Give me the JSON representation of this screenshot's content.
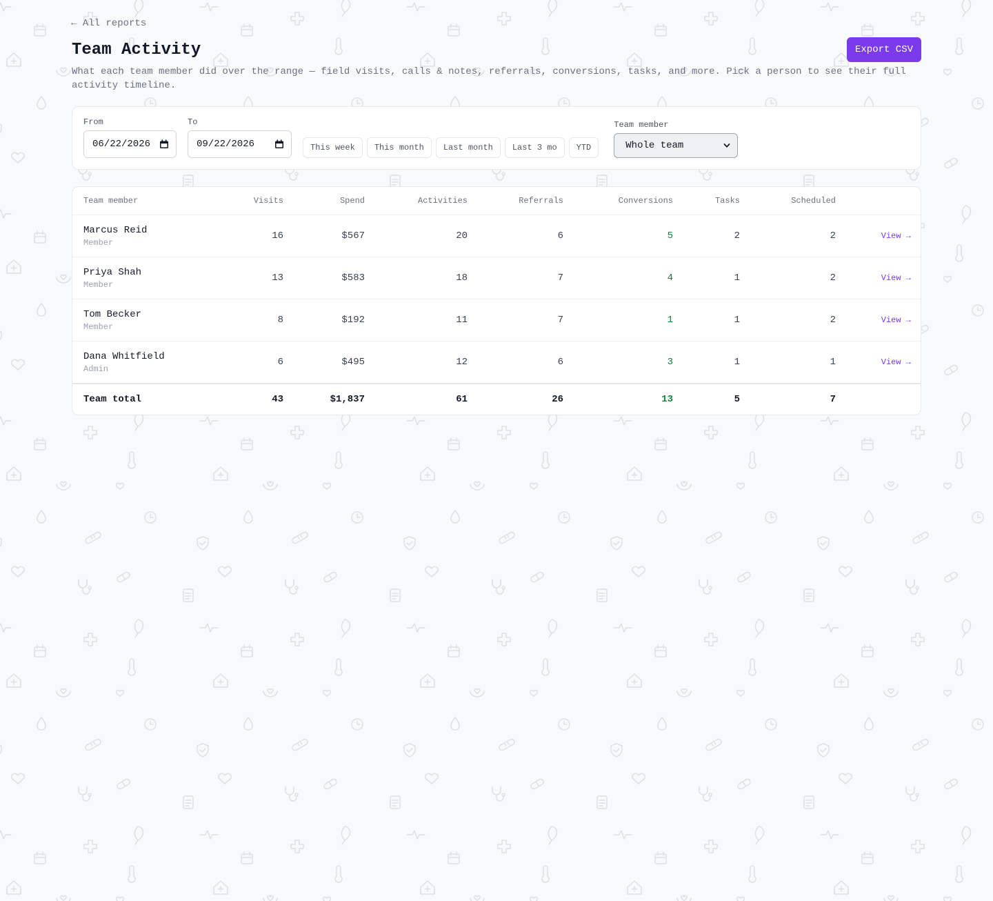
{
  "nav": {
    "back_label": "← All reports"
  },
  "header": {
    "title": "Team Activity",
    "subtitle": "What each team member did over the range — field visits, calls & notes, referrals, conversions, tasks, and more. Pick a person to see their full activity timeline.",
    "export_label": "Export CSV"
  },
  "filters": {
    "from_label": "From",
    "from_value": "06/22/2026",
    "to_label": "To",
    "to_value": "09/22/2026",
    "presets": [
      "This week",
      "This month",
      "Last month",
      "Last 3 mo",
      "YTD"
    ],
    "member_label": "Team member",
    "member_selected": "Whole team"
  },
  "table": {
    "columns": [
      "Team member",
      "Visits",
      "Spend",
      "Activities",
      "Referrals",
      "Conversions",
      "Tasks",
      "Scheduled",
      ""
    ],
    "rows": [
      {
        "name": "Marcus Reid",
        "role": "Member",
        "visits": "16",
        "spend": "$567",
        "activities": "20",
        "referrals": "6",
        "conversions": "5",
        "tasks": "2",
        "scheduled": "2",
        "action": "View →"
      },
      {
        "name": "Priya Shah",
        "role": "Member",
        "visits": "13",
        "spend": "$583",
        "activities": "18",
        "referrals": "7",
        "conversions": "4",
        "tasks": "1",
        "scheduled": "2",
        "action": "View →"
      },
      {
        "name": "Tom Becker",
        "role": "Member",
        "visits": "8",
        "spend": "$192",
        "activities": "11",
        "referrals": "7",
        "conversions": "1",
        "tasks": "1",
        "scheduled": "2",
        "action": "View →"
      },
      {
        "name": "Dana Whitfield",
        "role": "Admin",
        "visits": "6",
        "spend": "$495",
        "activities": "12",
        "referrals": "6",
        "conversions": "3",
        "tasks": "1",
        "scheduled": "1",
        "action": "View →"
      }
    ],
    "total": {
      "label": "Team total",
      "visits": "43",
      "spend": "$1,837",
      "activities": "61",
      "referrals": "26",
      "conversions": "13",
      "tasks": "5",
      "scheduled": "7"
    }
  },
  "colors": {
    "accent": "#7c3aed",
    "positive": "#15803d",
    "background": "#f8f9fb"
  },
  "background_icons": [
    "pulse-icon",
    "leaf-icon",
    "plus-cross-icon",
    "calendar-icon",
    "thermometer-icon",
    "house-plus-icon",
    "heart-hand-icon",
    "drop-icon",
    "clock-icon",
    "bandage-icon",
    "shield-check-icon",
    "heart-icon",
    "pill-icon",
    "stethoscope-icon",
    "clipboard-icon"
  ]
}
